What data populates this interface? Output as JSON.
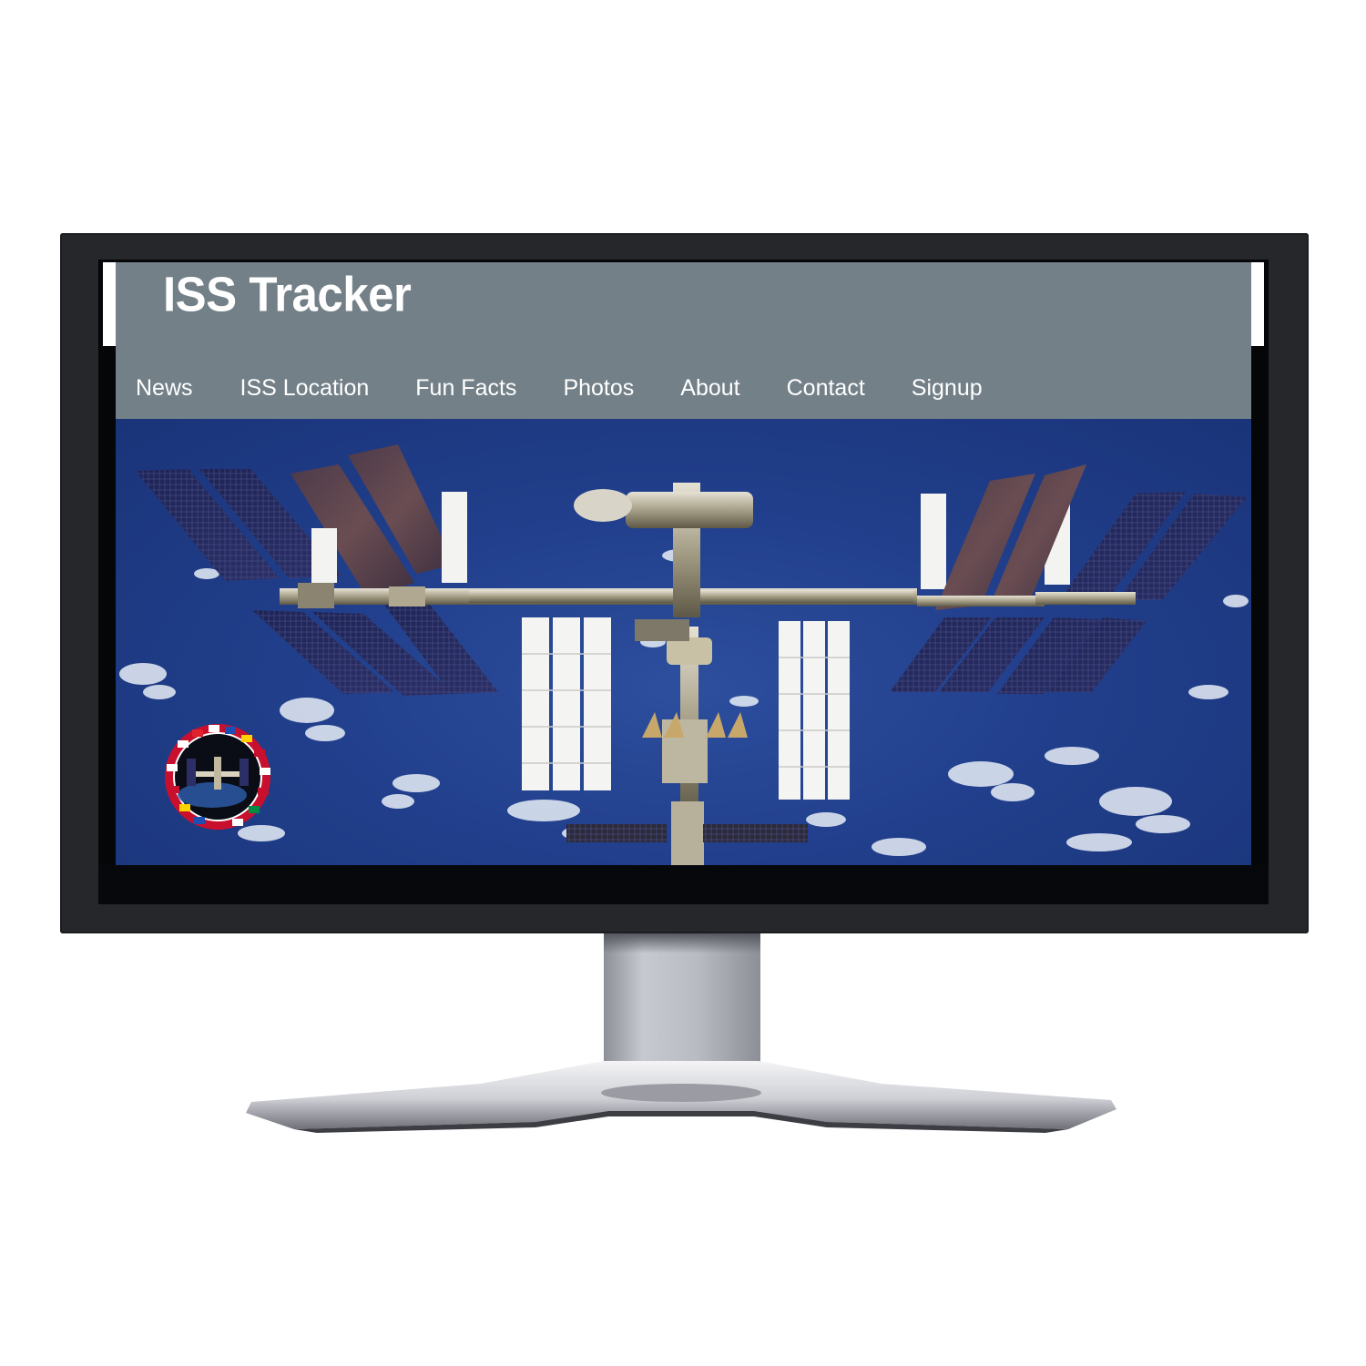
{
  "site": {
    "title": "ISS Tracker"
  },
  "nav": {
    "items": [
      {
        "label": "News",
        "name": "nav-news"
      },
      {
        "label": "ISS Location",
        "name": "nav-iss-location"
      },
      {
        "label": "Fun Facts",
        "name": "nav-fun-facts"
      },
      {
        "label": "Photos",
        "name": "nav-photos"
      },
      {
        "label": "About",
        "name": "nav-about"
      },
      {
        "label": "Contact",
        "name": "nav-contact"
      },
      {
        "label": "Signup",
        "name": "nav-signup"
      }
    ]
  },
  "hero": {
    "image_subject": "International Space Station over Earth",
    "emblem": "iss-program-patch-icon"
  },
  "colors": {
    "header_bg": "#738088",
    "nav_text": "#ffffff",
    "title_text": "#ffffff",
    "bezel": "#26272b",
    "ocean": "#213f8c"
  }
}
